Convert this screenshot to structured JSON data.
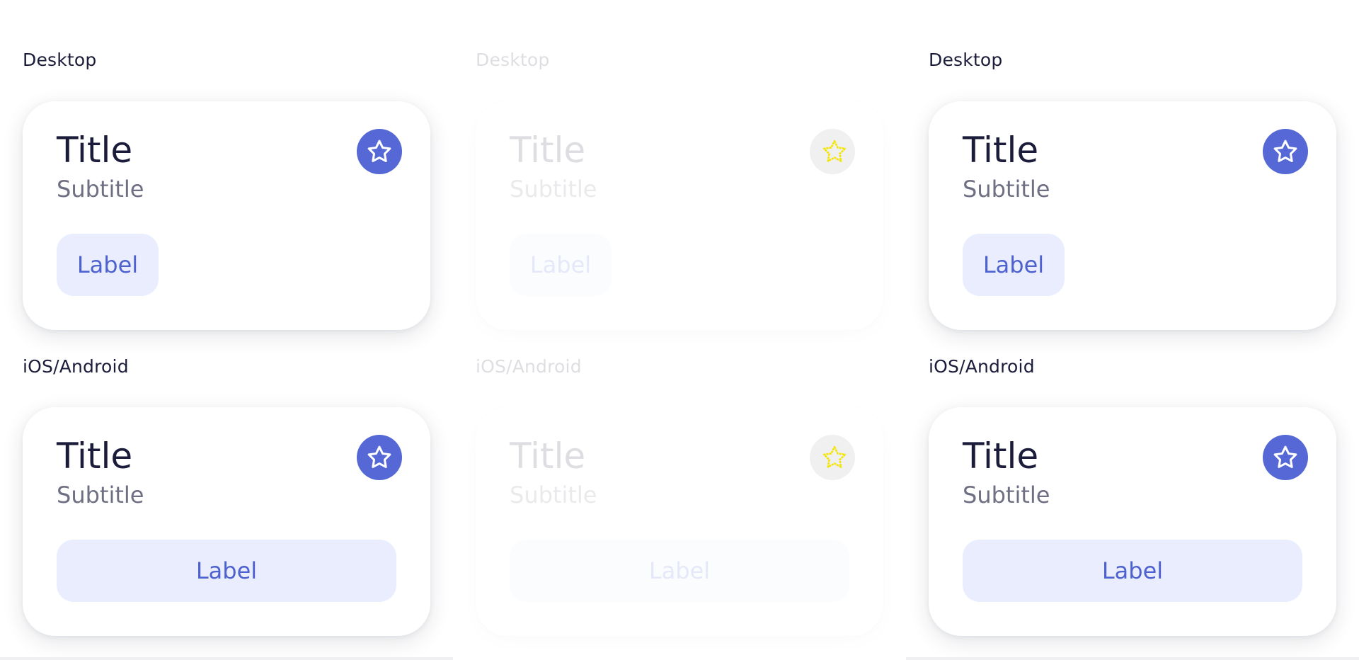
{
  "columns": [
    {
      "state": "default",
      "desktop": {
        "section_label": "Desktop",
        "card": {
          "title": "Title",
          "subtitle": "Subtitle",
          "button_label": "Label",
          "icon": "star-icon"
        }
      },
      "mobile": {
        "section_label": "iOS/Android",
        "card": {
          "title": "Title",
          "subtitle": "Subtitle",
          "button_label": "Label",
          "icon": "star-icon"
        }
      }
    },
    {
      "state": "disabled",
      "desktop": {
        "section_label": "Desktop",
        "card": {
          "title": "Title",
          "subtitle": "Subtitle",
          "button_label": "Label",
          "icon": "star-icon"
        }
      },
      "mobile": {
        "section_label": "iOS/Android",
        "card": {
          "title": "Title",
          "subtitle": "Subtitle",
          "button_label": "Label",
          "icon": "star-icon"
        }
      }
    },
    {
      "state": "default",
      "desktop": {
        "section_label": "Desktop",
        "card": {
          "title": "Title",
          "subtitle": "Subtitle",
          "button_label": "Label",
          "icon": "star-icon"
        }
      },
      "mobile": {
        "section_label": "iOS/Android",
        "card": {
          "title": "Title",
          "subtitle": "Subtitle",
          "button_label": "Label",
          "icon": "star-icon"
        }
      }
    }
  ],
  "colors": {
    "accent": "#5568d6",
    "button_bg": "#eaedfd",
    "button_text": "#4d62cf",
    "title_text": "#1b1c3a",
    "subtitle_text": "#6e6f82",
    "disabled_star": "#f2e600"
  }
}
